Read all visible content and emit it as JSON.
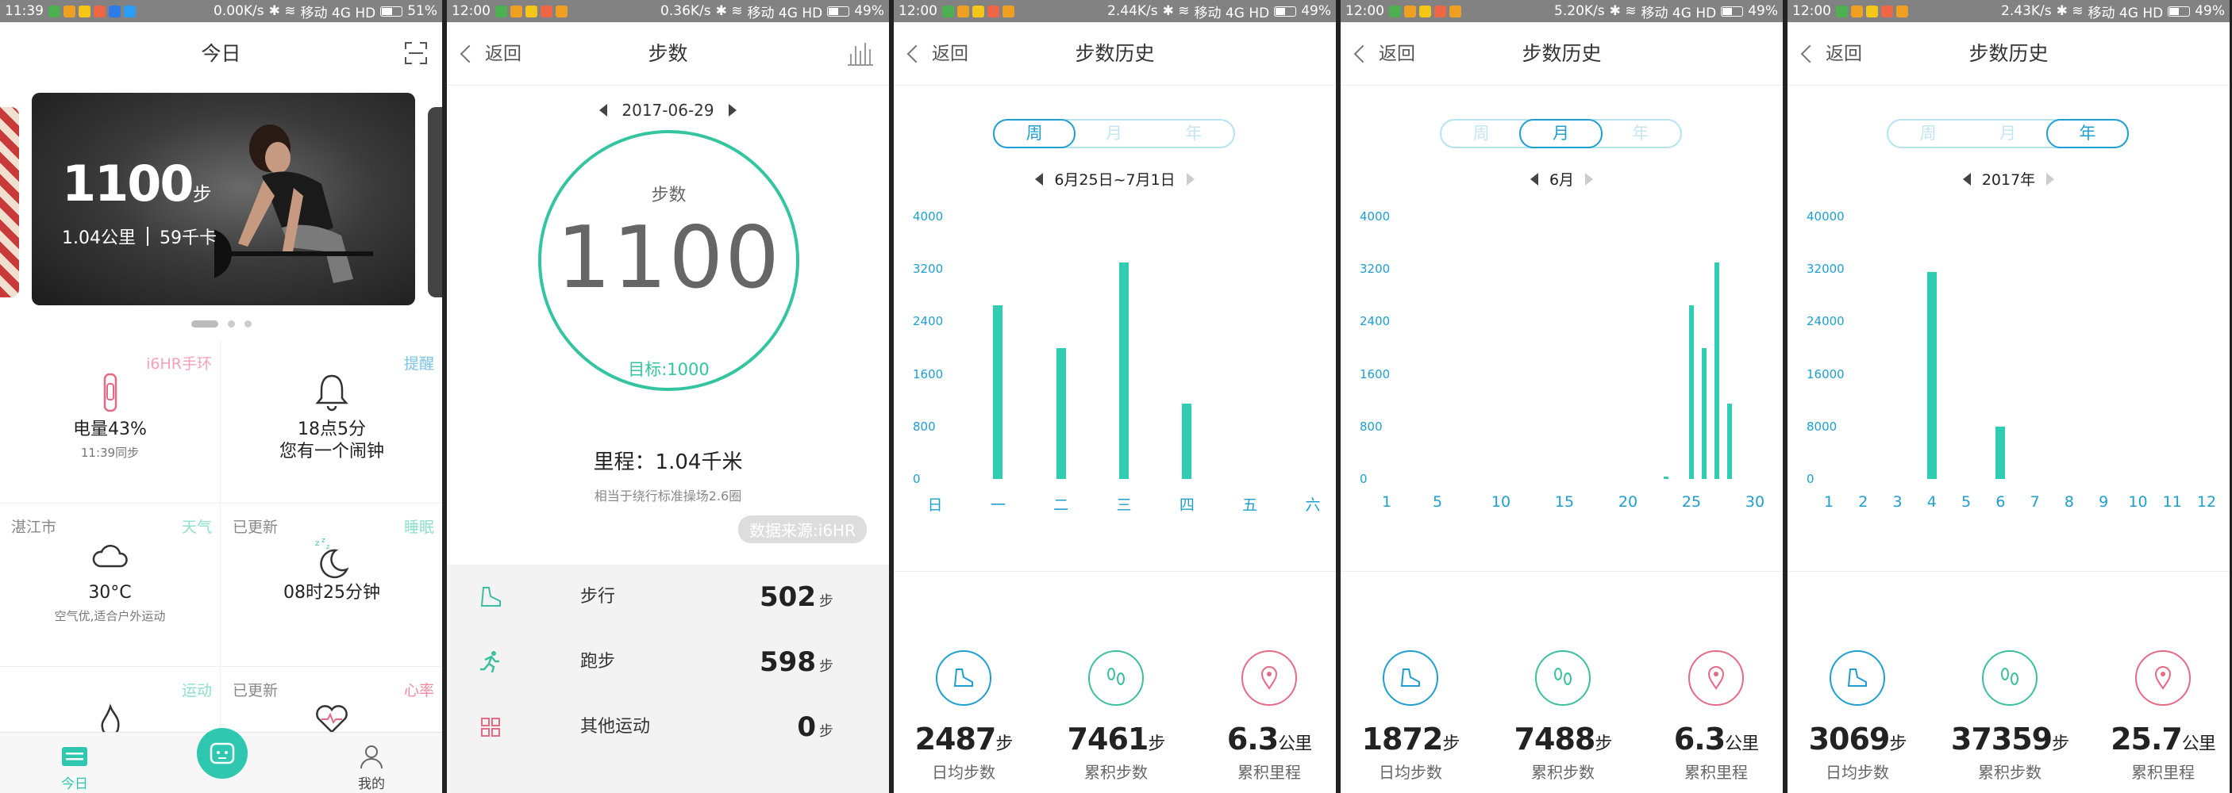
{
  "status_bars": [
    {
      "time": "11:39",
      "speed": "0.00K/s",
      "net": "移动 4G HD",
      "battery": "51%",
      "battery_level": 0.51
    },
    {
      "time": "12:00",
      "speed": "0.36K/s",
      "net": "移动 4G HD",
      "battery": "49%",
      "battery_level": 0.49
    },
    {
      "time": "12:00",
      "speed": "2.44K/s",
      "net": "移动 4G HD",
      "battery": "49%",
      "battery_level": 0.49
    },
    {
      "time": "12:00",
      "speed": "5.20K/s",
      "net": "移动 4G HD",
      "battery": "49%",
      "battery_level": 0.49
    },
    {
      "time": "12:00",
      "speed": "2.43K/s",
      "net": "移动 4G HD",
      "battery": "49%",
      "battery_level": 0.49
    }
  ],
  "today": {
    "title": "今日",
    "banner": {
      "steps": "1100",
      "steps_unit": "步",
      "distance": "1.04公里",
      "calories": "59千卡"
    },
    "cells": {
      "band": {
        "tag": "i6HR手环",
        "main": "电量43%",
        "sub": "11:39同步"
      },
      "reminder": {
        "tag": "提醒",
        "main": "18点5分\n您有一个闹钟"
      },
      "weather": {
        "left": "湛江市",
        "tag": "天气",
        "main": "30°C",
        "sub": "空气优,适合户外运动"
      },
      "sleep": {
        "left": "已更新",
        "tag": "睡眠",
        "main": "08时25分钟"
      },
      "sport": {
        "tag": "运动"
      },
      "heart": {
        "left": "已更新",
        "tag": "心率"
      }
    },
    "tabs": {
      "today": "今日",
      "mine": "我的"
    }
  },
  "steps": {
    "back": "返回",
    "title": "步数",
    "date": "2017-06-29",
    "ring_label": "步数",
    "count": "1100",
    "goal": "目标:1000",
    "distance": "里程：1.04千米",
    "distance_note": "相当于绕行标准操场2.6圈",
    "source": "数据来源:i6HR",
    "activities": [
      {
        "name": "步行",
        "value": "502",
        "unit": "步"
      },
      {
        "name": "跑步",
        "value": "598",
        "unit": "步"
      },
      {
        "name": "其他运动",
        "value": "0",
        "unit": "步"
      }
    ]
  },
  "history": {
    "back": "返回",
    "title": "步数历史",
    "seg": [
      "周",
      "月",
      "年"
    ],
    "stat_labels": [
      "日均步数",
      "累积步数",
      "累积里程"
    ],
    "units": [
      "步",
      "步",
      "公里"
    ]
  },
  "chart_data": [
    {
      "type": "bar",
      "period": "6月25日~7月1日",
      "active_tab": "周",
      "yticks": [
        "4000",
        "3200",
        "2400",
        "1600",
        "800",
        "0"
      ],
      "ylim": [
        0,
        4000
      ],
      "categories": [
        "日",
        "一",
        "二",
        "三",
        "四",
        "五",
        "六"
      ],
      "values": [
        0,
        2650,
        2000,
        3300,
        1150,
        0,
        0
      ],
      "stats": [
        "2487",
        "7461",
        "6.3"
      ]
    },
    {
      "type": "bar",
      "period": "6月",
      "active_tab": "月",
      "yticks": [
        "4000",
        "3200",
        "2400",
        "1600",
        "800",
        "0"
      ],
      "ylim": [
        0,
        4000
      ],
      "xticks": [
        "1",
        "5",
        "10",
        "15",
        "20",
        "25",
        "30"
      ],
      "x": [
        1,
        2,
        3,
        4,
        5,
        6,
        7,
        8,
        9,
        10,
        11,
        12,
        13,
        14,
        15,
        16,
        17,
        18,
        19,
        20,
        21,
        22,
        23,
        24,
        25,
        26,
        27,
        28,
        29,
        30
      ],
      "values": [
        0,
        0,
        0,
        0,
        0,
        0,
        0,
        0,
        0,
        0,
        0,
        0,
        0,
        0,
        0,
        0,
        0,
        0,
        0,
        0,
        0,
        0,
        40,
        0,
        2650,
        2000,
        3300,
        1150,
        0,
        0
      ],
      "stats": [
        "1872",
        "7488",
        "6.3"
      ]
    },
    {
      "type": "bar",
      "period": "2017年",
      "active_tab": "年",
      "yticks": [
        "40000",
        "32000",
        "24000",
        "16000",
        "8000",
        "0"
      ],
      "ylim": [
        0,
        40000
      ],
      "categories": [
        "1",
        "2",
        "3",
        "4",
        "5",
        "6",
        "7",
        "8",
        "9",
        "10",
        "11",
        "12"
      ],
      "values": [
        0,
        0,
        0,
        31500,
        0,
        8000,
        0,
        0,
        0,
        0,
        0,
        0
      ],
      "stats": [
        "3069",
        "37359",
        "25.7"
      ]
    }
  ]
}
